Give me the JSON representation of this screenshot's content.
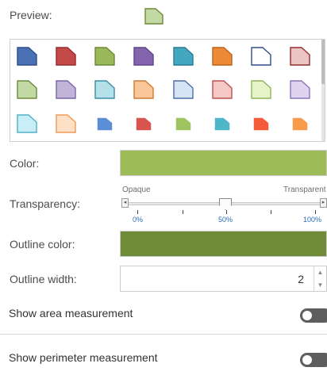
{
  "preview": {
    "label": "Preview:",
    "fill": "#c2d9a4",
    "stroke": "#6d8b37"
  },
  "palette": [
    {
      "fill": "#4a71b3",
      "stroke": "#2d4f8a"
    },
    {
      "fill": "#c44a4a",
      "stroke": "#952c2c"
    },
    {
      "fill": "#9ab85a",
      "stroke": "#6d8b37"
    },
    {
      "fill": "#8465ad",
      "stroke": "#5d4489"
    },
    {
      "fill": "#44a7c0",
      "stroke": "#277d95"
    },
    {
      "fill": "#ec8a38",
      "stroke": "#bd6219"
    },
    {
      "fill": "#ffffff",
      "stroke": "#2d4f8a"
    },
    {
      "fill": "#ecc4c4",
      "stroke": "#952c2c"
    },
    {
      "fill": "#c2d9a4",
      "stroke": "#6d8b37"
    },
    {
      "fill": "#c2b4d9",
      "stroke": "#7a66a6"
    },
    {
      "fill": "#b4e0e8",
      "stroke": "#3a8ea5"
    },
    {
      "fill": "#f9c79a",
      "stroke": "#cf7a33"
    },
    {
      "fill": "#d6e4f5",
      "stroke": "#4a6ea8"
    },
    {
      "fill": "#f6c9c9",
      "stroke": "#c24e4e"
    },
    {
      "fill": "#e6f4c9",
      "stroke": "#8fb55a"
    },
    {
      "fill": "#ded4ef",
      "stroke": "#8a74bb"
    },
    {
      "fill": "#c9eef5",
      "stroke": "#4fb0c8"
    },
    {
      "fill": "#fde0c6",
      "stroke": "#f09a56"
    },
    {
      "fill": "#5a8ed6",
      "stroke": "#5a8ed6"
    },
    {
      "fill": "#d9534f",
      "stroke": "#d9534f"
    },
    {
      "fill": "#9dc45f",
      "stroke": "#9dc45f"
    },
    {
      "fill": "#4db6c8",
      "stroke": "#4db6c8"
    },
    {
      "fill": "#f55a3a",
      "stroke": "#f55a3a"
    },
    {
      "fill": "#f79b4a",
      "stroke": "#f79b4a"
    }
  ],
  "color": {
    "label": "Color:",
    "value": "#9dbc56"
  },
  "transparency": {
    "label": "Transparency:",
    "min_label": "Opaque",
    "max_label": "Transparent",
    "ticks": [
      "0%",
      "50%",
      "100%"
    ],
    "value_percent": 50
  },
  "outline_color": {
    "label": "Outline color:",
    "value": "#6f8b37"
  },
  "outline_width": {
    "label": "Outline width:",
    "value": "2"
  },
  "toggles": {
    "area": "Show area measurement",
    "perimeter": "Show perimeter measurement"
  },
  "icons": {
    "increment": "chevron-up-icon",
    "decrement": "chevron-down-icon",
    "slider_min": "chevron-left-icon",
    "slider_max": "chevron-right-icon"
  }
}
